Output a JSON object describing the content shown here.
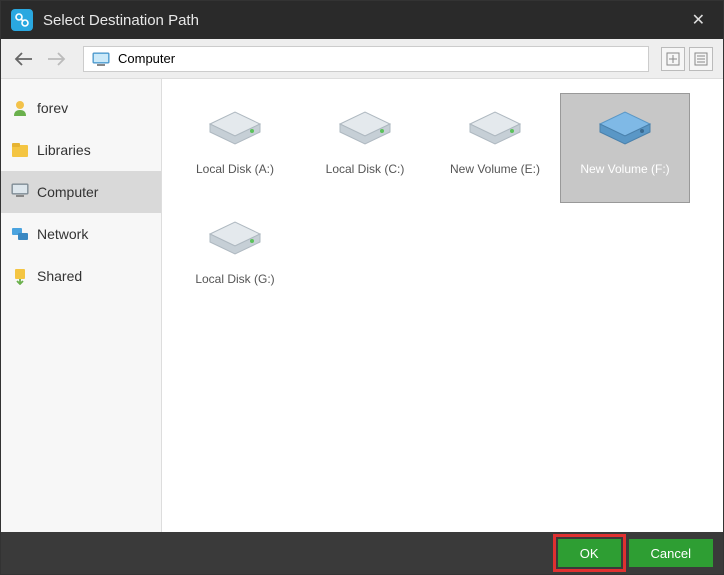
{
  "window": {
    "title": "Select Destination Path"
  },
  "breadcrumb": {
    "label": "Computer"
  },
  "sidebar": {
    "items": [
      {
        "label": "forev"
      },
      {
        "label": "Libraries"
      },
      {
        "label": "Computer"
      },
      {
        "label": "Network"
      },
      {
        "label": "Shared"
      }
    ]
  },
  "drives": [
    {
      "label": "Local Disk (A:)"
    },
    {
      "label": "Local Disk (C:)"
    },
    {
      "label": "New Volume (E:)"
    },
    {
      "label": "New Volume (F:)"
    },
    {
      "label": "Local Disk (G:)"
    }
  ],
  "footer": {
    "ok": "OK",
    "cancel": "Cancel"
  }
}
